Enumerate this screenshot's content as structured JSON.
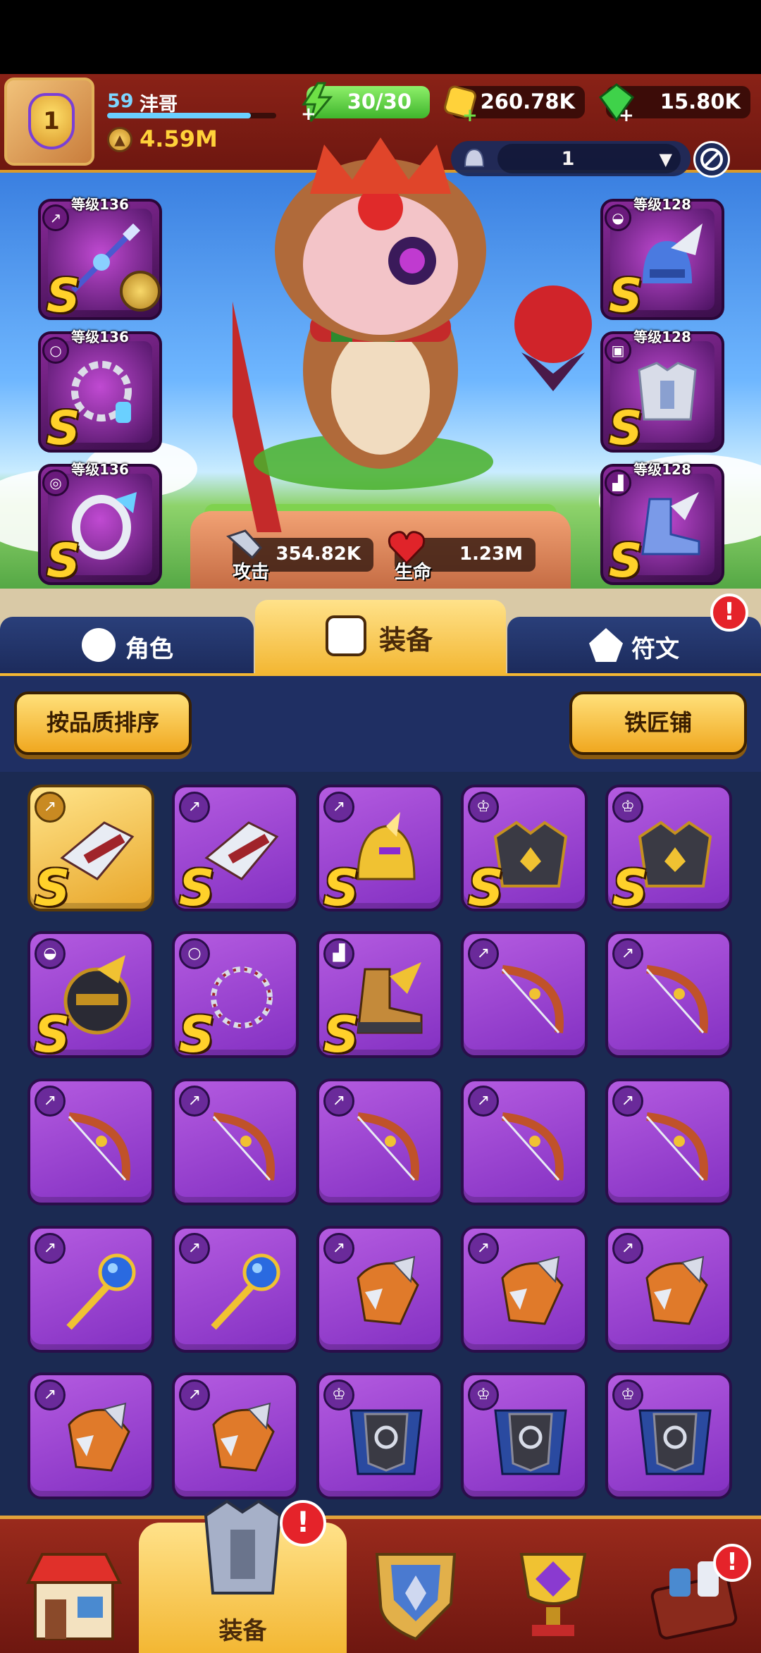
{
  "player": {
    "level": "59",
    "name": "沣哥",
    "power": "4.59M",
    "xp_fraction": 0.85,
    "avatar_badge": "1"
  },
  "resources": {
    "energy": "30/30",
    "gold": "260.78K",
    "gems": "15.80K"
  },
  "selector": {
    "value": "1",
    "caret": "▼"
  },
  "equipped": {
    "left": [
      {
        "level": "等级136",
        "grade": "S",
        "icon": "weapon-icon",
        "item": "spear-icon"
      },
      {
        "level": "等级136",
        "grade": "S",
        "icon": "necklace-icon",
        "item": "necklace-icon"
      },
      {
        "level": "等级136",
        "grade": "S",
        "icon": "ring-icon",
        "item": "ring-icon"
      }
    ],
    "right": [
      {
        "level": "等级128",
        "grade": "S",
        "icon": "helmet-icon",
        "item": "winged-helmet-icon"
      },
      {
        "level": "等级128",
        "grade": "S",
        "icon": "armor-icon",
        "item": "chestplate-icon"
      },
      {
        "level": "等级128",
        "grade": "S",
        "icon": "boots-icon",
        "item": "winged-boots-icon"
      }
    ]
  },
  "stats": {
    "attack_label": "攻击",
    "attack_value": "354.82K",
    "hp_label": "生命",
    "hp_value": "1.23M"
  },
  "tabs": {
    "role": "角色",
    "equipment": "装备",
    "rune": "符文",
    "rune_alert": "!"
  },
  "actions": {
    "sort_label": "按品质排序",
    "smith_label": "铁匠铺"
  },
  "inventory": {
    "grade_label": "S",
    "rows": [
      [
        "crossbow-s-gold",
        "crossbow-s",
        "golden-helmet-s",
        "dark-armor-s",
        "dark-armor-s"
      ],
      [
        "dark-helmet-s",
        "chain-necklace-s",
        "golden-boots-s",
        "bow",
        "bow"
      ],
      [
        "bow",
        "bow",
        "bow",
        "bow",
        "bow"
      ],
      [
        "staff",
        "staff",
        "gauntlet",
        "gauntlet",
        "gauntlet"
      ],
      [
        "gauntlet",
        "gauntlet",
        "cape-armor",
        "cape-armor",
        "cape-armor"
      ]
    ]
  },
  "bottom_nav": {
    "active_label": "装备",
    "alert": "!"
  },
  "colors": {
    "purple_cell": "#9a3fd0",
    "gold_cell": "#f0b53a",
    "grade_gold": "#ffd12a",
    "header_red": "#8a2217",
    "nav_blue": "#1f2f63"
  }
}
